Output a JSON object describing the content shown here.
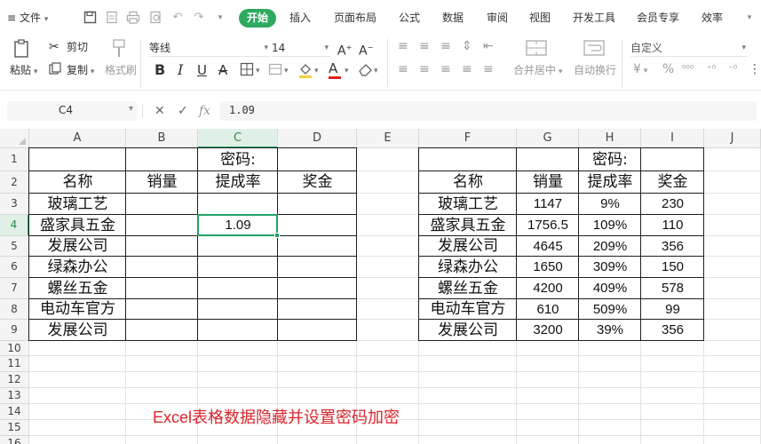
{
  "menu": {
    "file_label": "文件",
    "tabs": [
      {
        "label": "开始",
        "active": true
      },
      {
        "label": "插入"
      },
      {
        "label": "页面布局"
      },
      {
        "label": "公式"
      },
      {
        "label": "数据"
      },
      {
        "label": "审阅"
      },
      {
        "label": "视图"
      },
      {
        "label": "开发工具"
      },
      {
        "label": "会员专享"
      },
      {
        "label": "效率"
      }
    ]
  },
  "ribbon": {
    "cut": "剪切",
    "paste": "粘贴",
    "copy": "复制",
    "format_painter": "格式刷",
    "font_name": "等线",
    "font_size": "14",
    "merge_center": "合并居中",
    "wrap_text": "自动换行",
    "number_format": "自定义",
    "bold": "B",
    "italic": "I",
    "underline": "U",
    "strike": "A",
    "font_color_letter": "A",
    "fill_color_hex": "#f4d03f",
    "font_color_hex": "#e02020",
    "currency": "¥",
    "percent": "%"
  },
  "formula_bar": {
    "name_box": "C4",
    "fx": "fx",
    "value": "1.09"
  },
  "sheet": {
    "columns": [
      "A",
      "B",
      "C",
      "D",
      "E",
      "F",
      "G",
      "H",
      "I",
      "J"
    ],
    "rows": [
      "1",
      "2",
      "3",
      "4",
      "5",
      "6",
      "7",
      "8",
      "9",
      "10",
      "11",
      "12",
      "13",
      "14",
      "15",
      "16"
    ],
    "selected_cell": "C4",
    "cells": {
      "C1": "密码:",
      "A2": "名称",
      "B2": "销量",
      "C2": "提成率",
      "D2": "奖金",
      "A3": "玻璃工艺",
      "A4": "盛家具五金",
      "C4": "1.09",
      "A5": "发展公司",
      "A6": "绿森办公",
      "A7": "螺丝五金",
      "A8": "电动车官方",
      "A9": "发展公司",
      "H1": "密码:",
      "F2": "名称",
      "G2": "销量",
      "H2": "提成率",
      "I2": "奖金",
      "F3": "玻璃工艺",
      "G3": "1147",
      "H3": "9%",
      "I3": "230",
      "F4": "盛家具五金",
      "G4": "1756.5",
      "H4": "109%",
      "I4": "110",
      "F5": "发展公司",
      "G5": "4645",
      "H5": "209%",
      "I5": "356",
      "F6": "绿森办公",
      "G6": "1650",
      "H6": "309%",
      "I6": "150",
      "F7": "螺丝五金",
      "G7": "4200",
      "H7": "409%",
      "I7": "578",
      "F8": "电动车官方",
      "G8": "610",
      "H8": "509%",
      "I8": "99",
      "F9": "发展公司",
      "G9": "3200",
      "H9": "39%",
      "I9": "356"
    }
  },
  "caption": "Excel表格数据隐藏并设置密码加密",
  "colors": {
    "accent": "#2eaa5f",
    "selection": "#21a366",
    "caption": "#d8262d"
  }
}
